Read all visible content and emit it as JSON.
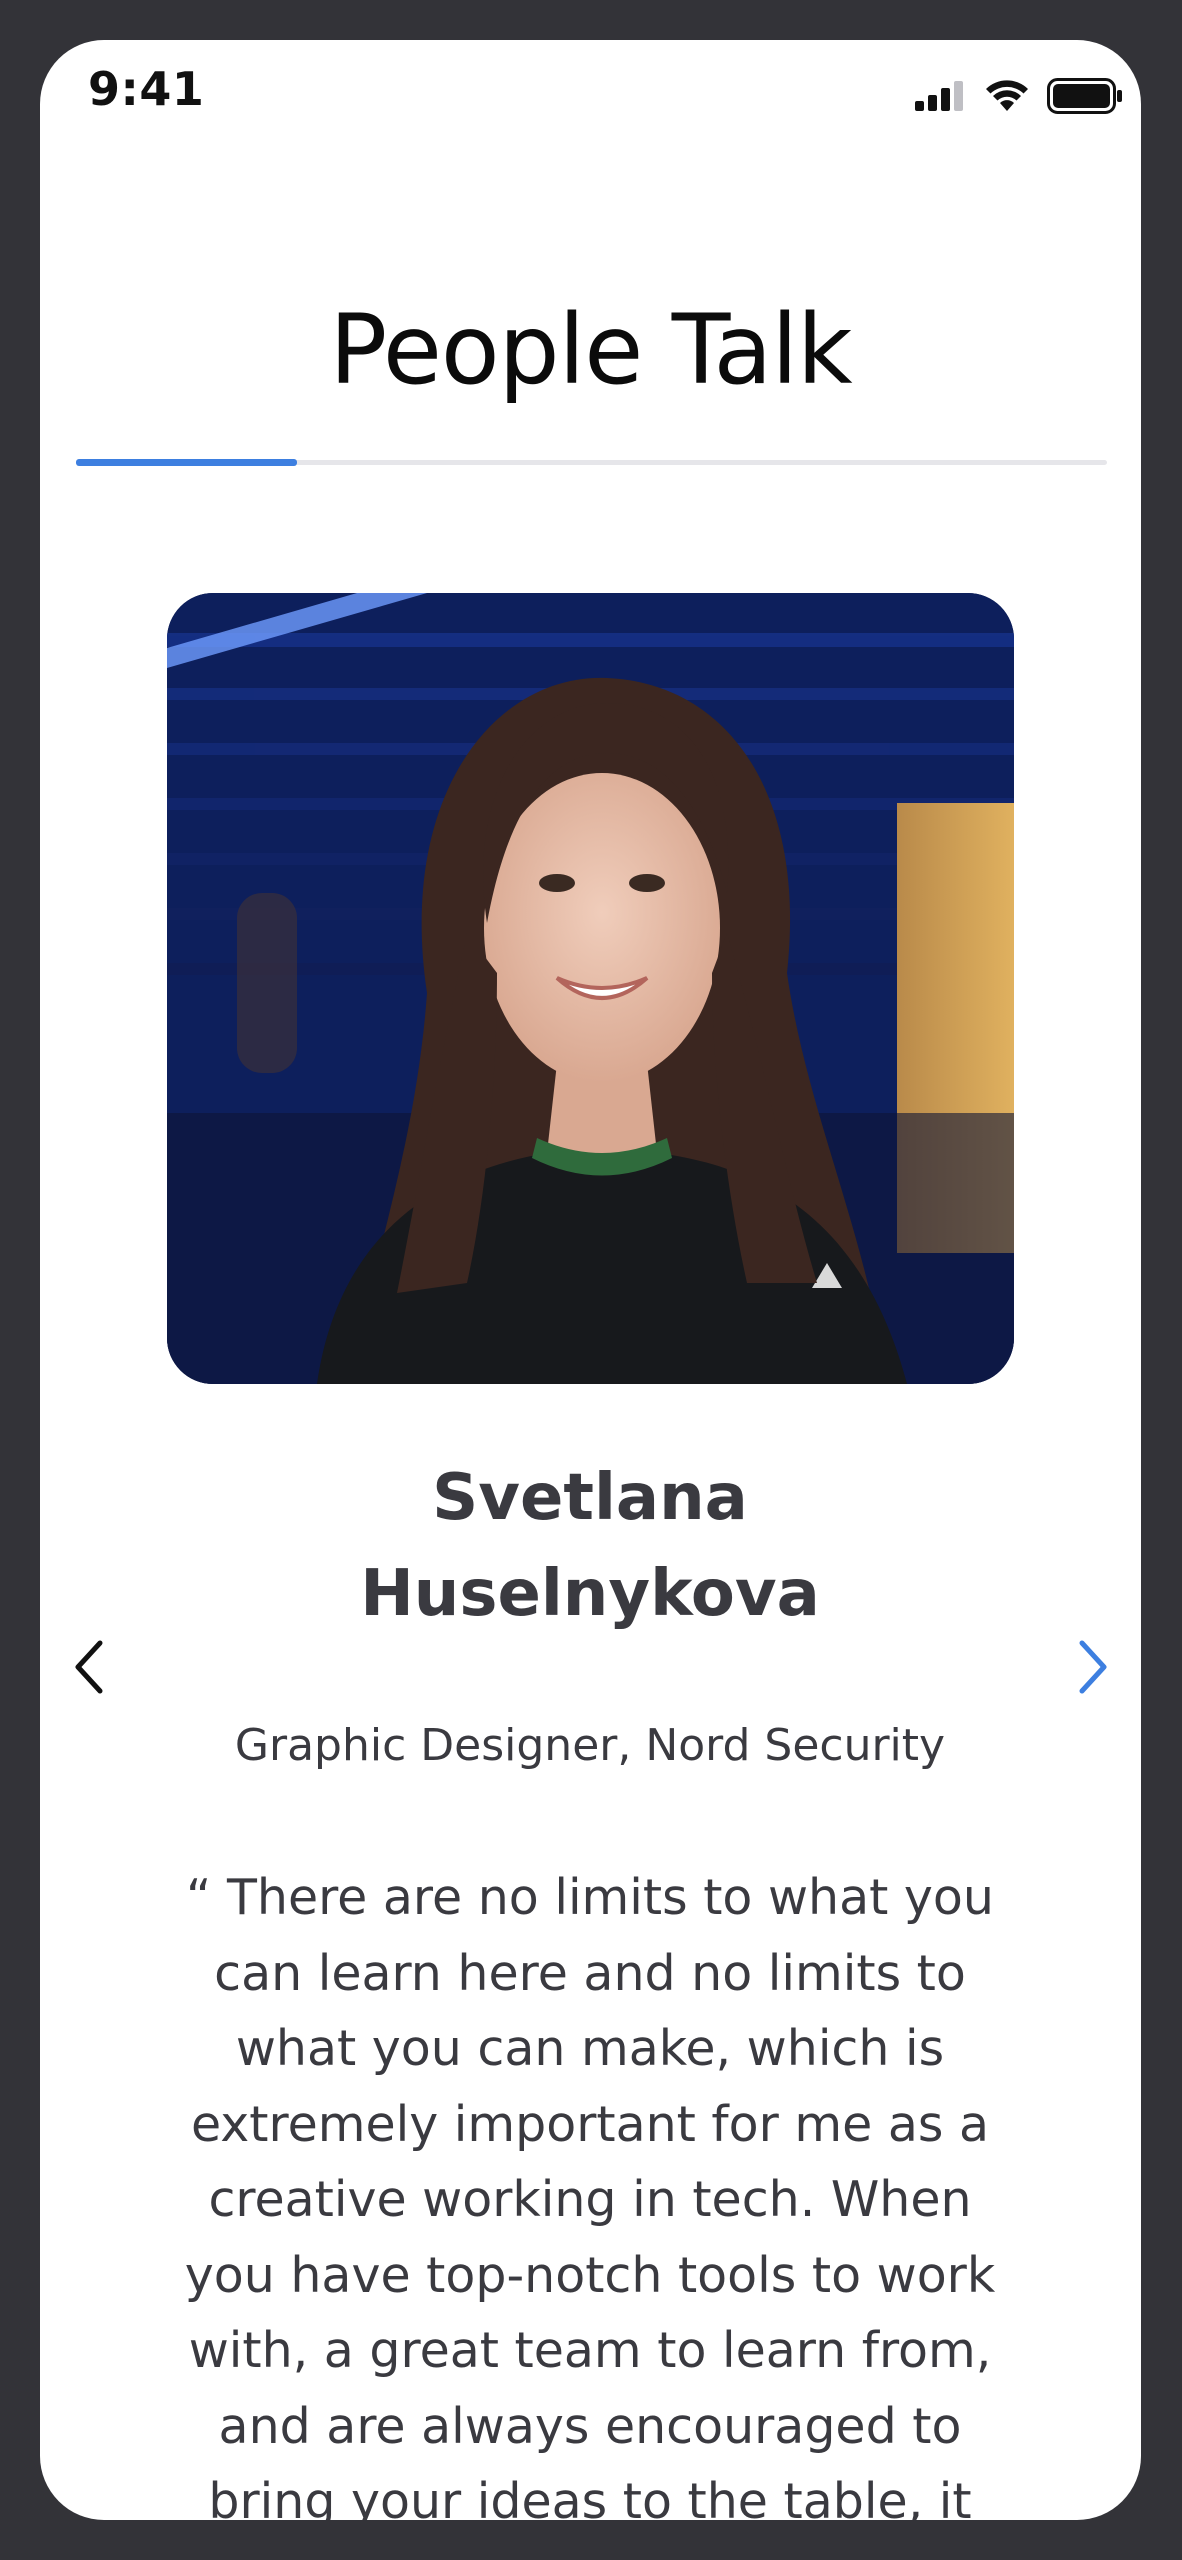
{
  "status_bar": {
    "time": "9:41",
    "icons": [
      "cellular-signal-icon",
      "wifi-icon",
      "battery-icon"
    ]
  },
  "page": {
    "title": "People Talk"
  },
  "carousel": {
    "progress_fraction": 0.214,
    "accent_color": "#3d7fe0",
    "prev_icon": "chevron-left-icon",
    "next_icon": "chevron-right-icon",
    "testimonial": {
      "photo_alt": "Portrait of Svetlana Huselnykova",
      "name_lines": [
        "Svetlana",
        "Huselnykova"
      ],
      "role": "Graphic Designer, Nord Security",
      "quote_lines": [
        "“ There are no limits to what you",
        "can learn here and no limits to",
        "what you can make, which is",
        "extremely important for me as a",
        "creative working in tech. When",
        "you have top-notch tools to work",
        "with, a great team to learn from,",
        "and are always encouraged to",
        "bring your ideas to the table, it"
      ]
    }
  }
}
